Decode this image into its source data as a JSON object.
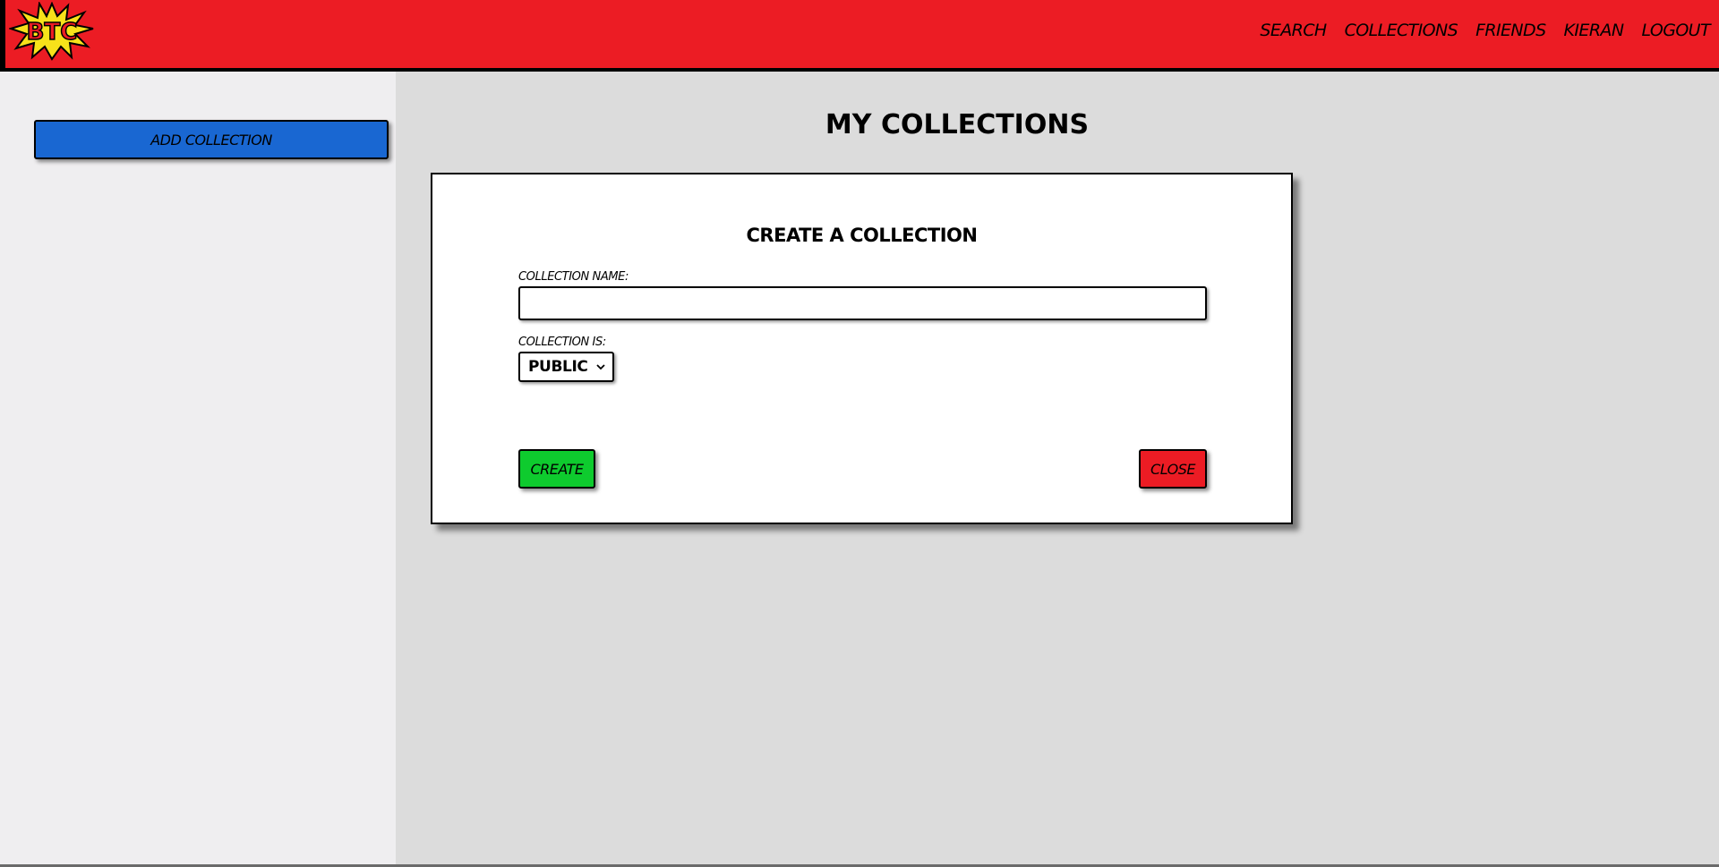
{
  "header": {
    "logo_text": "BTC",
    "nav": [
      {
        "label": "SEARCH"
      },
      {
        "label": "COLLECTIONS"
      },
      {
        "label": "FRIENDS"
      },
      {
        "label": "KIERAN"
      },
      {
        "label": "LOGOUT"
      }
    ]
  },
  "sidebar": {
    "add_collection_label": "ADD COLLECTION"
  },
  "main": {
    "title": "MY COLLECTIONS"
  },
  "modal": {
    "title": "CREATE A COLLECTION",
    "name_label": "COLLECTION NAME:",
    "name_value": "",
    "visibility_label": "COLLECTION IS:",
    "visibility_value": "PUBLIC",
    "create_label": "CREATE",
    "close_label": "CLOSE"
  },
  "colors": {
    "header": "#ec1c24",
    "add_button": "#1967d2",
    "create_button": "#0ecb2e",
    "close_button": "#ec1c24",
    "sidebar_bg": "#efeef0",
    "main_bg": "#dcdcdc"
  }
}
